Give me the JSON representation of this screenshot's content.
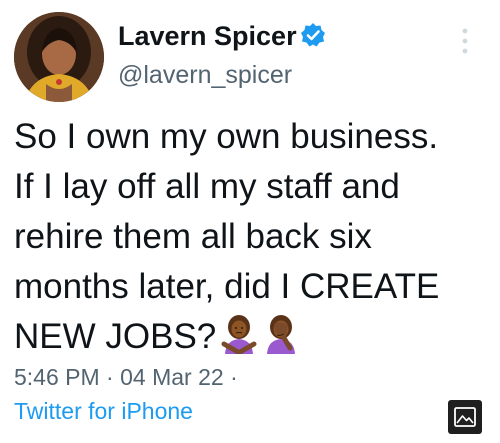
{
  "user": {
    "display_name": "Lavern Spicer",
    "handle": "@lavern_spicer",
    "verified": true
  },
  "tweet": {
    "lines": [
      "So I own my own business.",
      "If I lay off all my staff and",
      "rehire them all back six",
      "months later, did I CREATE",
      "NEW JOBS?"
    ],
    "emojis": [
      "person-gesturing-no",
      "person-facepalming"
    ]
  },
  "meta": {
    "time": "5:46 PM",
    "date": "04 Mar 22",
    "source": "Twitter for iPhone"
  },
  "icons": {
    "verified": "verified-badge-icon",
    "more": "more-vertical-icon",
    "media": "image-icon"
  },
  "colors": {
    "accent": "#1d9bf0",
    "secondary_text": "#536471",
    "primary_text": "#0f1419"
  }
}
